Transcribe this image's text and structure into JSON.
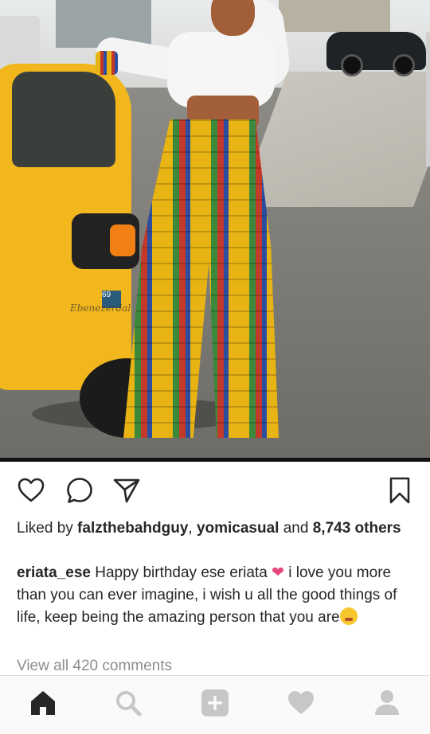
{
  "post": {
    "photo": {
      "watermark": "Ebenezerdal",
      "plate": "69"
    },
    "actions": {
      "like_icon": "heart-outline-icon",
      "comment_icon": "comment-bubble-icon",
      "share_icon": "paper-plane-icon",
      "save_icon": "bookmark-icon"
    },
    "likes": {
      "prefix": "Liked by ",
      "user1": "falzthebahdguy",
      "separator": ", ",
      "user2": "yomicasual",
      "and": " and ",
      "count": "8,743",
      "suffix": " others"
    },
    "caption": {
      "username": "eriata_ese",
      "text_part1": " Happy birthday ese eriata ",
      "heart_emoji": "❤",
      "text_part2": " i love you more than you can ever imagine, i wish u all the good things of life, keep being the amazing person that you are"
    },
    "view_comments": "View all 420 comments"
  },
  "bottom_nav": {
    "items": [
      {
        "name": "home",
        "icon": "home-icon",
        "active": true
      },
      {
        "name": "search",
        "icon": "search-icon"
      },
      {
        "name": "add",
        "icon": "add-post-icon"
      },
      {
        "name": "activity",
        "icon": "heart-icon"
      },
      {
        "name": "profile",
        "icon": "profile-icon"
      }
    ]
  },
  "colors": {
    "text": "#262626",
    "muted": "#8e8e8e",
    "inactive_icon": "#c7c7c7",
    "heart_emoji": "#e5457a"
  }
}
